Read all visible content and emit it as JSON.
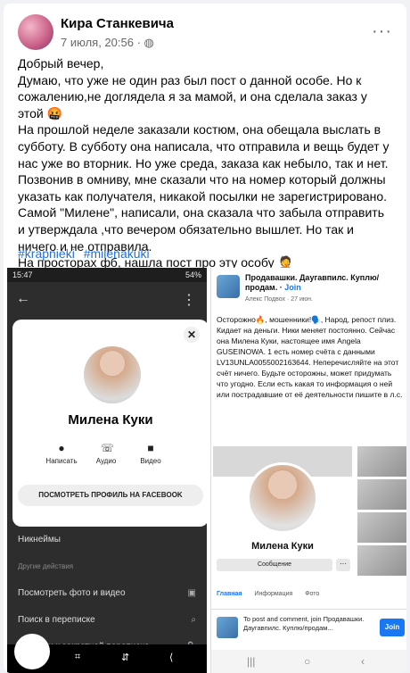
{
  "post": {
    "author": "Кира Станкевича",
    "date": "7 июля, 20:56",
    "audience_icon": "globe-icon",
    "more_label": "···",
    "paragraphs": [
      "Добрый вечер,",
      "Думаю, что уже не один раз был пост о данной особе. Но к сожалению,не доглядела я за мамой, и она сделала заказ у этой 🤬",
      "На прошлой неделе заказали костюм, она обещала выслать в субботу. В субботу она написала, что отправила и вещь будет у нас уже во вторник. Но уже среда, заказа как небыло, так и нет. Позвонив в омниву, мне сказали что на номер который должны указать как получателя, никакой посылки не зарегистрировано. Самой \"Милене\", написали, она сказала что забыла отправить и утверждала ,что вечером обязательно вышлет. Но так и ничего и не отправила.",
      "На просторах фб, нашла пост про эту особу 🤦"
    ],
    "hashtags": [
      "#krapnieki",
      "#milenakuki"
    ]
  },
  "left_screenshot": {
    "time": "15:47",
    "status_right": "54%",
    "profile_name": "Милена Куки",
    "actions": [
      "Написать",
      "Аудио",
      "Видео"
    ],
    "profile_button": "ПОСМОТРЕТЬ ПРОФИЛЬ НА FACEBOOK",
    "list": [
      "Никнеймы",
      "Другие действия",
      "Посмотреть фото и видео",
      "Поиск в переписке",
      "Перейти к секретной переписке"
    ]
  },
  "right_screenshot": {
    "group_name": "Продавашки. Даугавпилс. Куплю/продам.",
    "join": "Join",
    "author_line": "Алекс Подвох · 27 июн.",
    "warning": "Осторожно🔥, мошенники!🗣️, Народ, репост плиз. Кидает на деньги. Ники меняет постоянно. Сейчас она Милена Куки, настоящее имя Angela GUSEINOWA. 1 есть номер счёта с данными LV13UNLA0055002163644. Неперечисляйте на этот счёт ничего. Будьте осторожны, может придумать что угодно. Если есть какая то информация о ней или пострадавшие от её деятельности пишите в л.с.",
    "profile_name": "Милена Куки",
    "message_button": "Сообщение",
    "tabs": [
      "Главная",
      "Информация",
      "Фото"
    ],
    "join_text": "To post and comment, join Продавашки. Даугавпилс. Куплю/продам...",
    "join_button": "Join"
  }
}
